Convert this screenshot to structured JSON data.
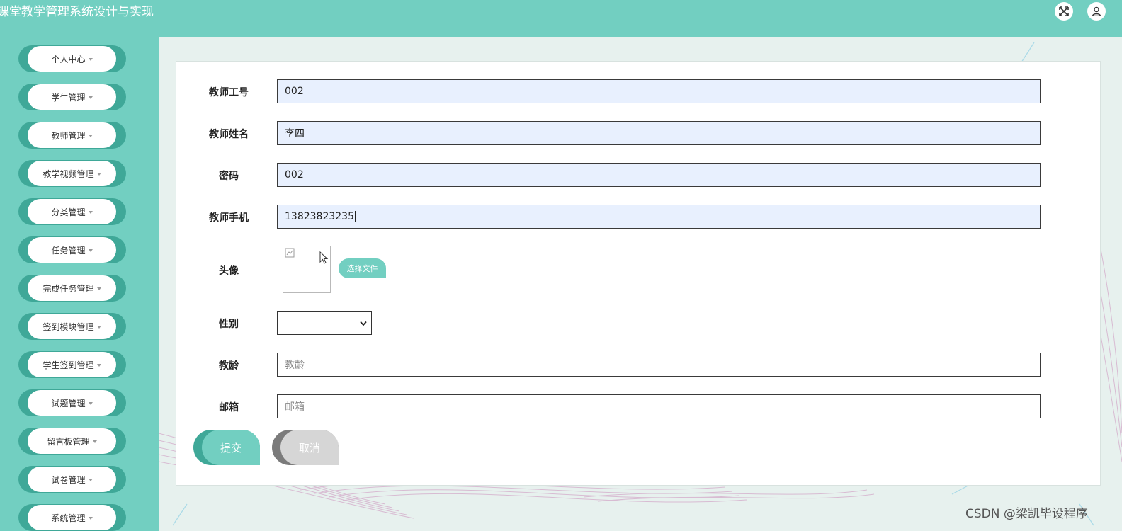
{
  "header": {
    "title": "课堂教学管理系统设计与实现",
    "fullscreen_icon": "expand-icon",
    "user_icon": "user-icon"
  },
  "sidebar": {
    "items": [
      {
        "label": "个人中心"
      },
      {
        "label": "学生管理"
      },
      {
        "label": "教师管理"
      },
      {
        "label": "教学视频管理"
      },
      {
        "label": "分类管理"
      },
      {
        "label": "任务管理"
      },
      {
        "label": "完成任务管理"
      },
      {
        "label": "签到模块管理"
      },
      {
        "label": "学生签到管理"
      },
      {
        "label": "试题管理"
      },
      {
        "label": "留言板管理"
      },
      {
        "label": "试卷管理"
      },
      {
        "label": "系统管理"
      }
    ]
  },
  "form": {
    "teacher_id": {
      "label": "教师工号",
      "value": "002"
    },
    "teacher_name": {
      "label": "教师姓名",
      "value": "李四"
    },
    "password": {
      "label": "密码",
      "value": "002"
    },
    "phone": {
      "label": "教师手机",
      "value": "13823823235"
    },
    "avatar": {
      "label": "头像",
      "button": "选择文件"
    },
    "gender": {
      "label": "性别",
      "value": ""
    },
    "years": {
      "label": "教龄",
      "placeholder": "教龄"
    },
    "email": {
      "label": "邮箱",
      "placeholder": "邮箱"
    },
    "submit": "提交",
    "cancel": "取消"
  },
  "watermark": "CSDN @梁凯毕设程序",
  "colors": {
    "primary": "#72cfc1",
    "primary_dark": "#3fa898",
    "panel_bg": "#ffffff",
    "autofill_bg": "#e8f0fe"
  }
}
